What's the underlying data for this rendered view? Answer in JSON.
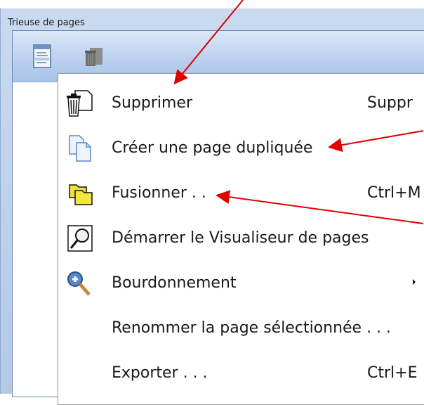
{
  "window": {
    "title": "Trieuse de pages"
  },
  "toolbar": {
    "icons": [
      "page-sorter-icon",
      "trash-icon"
    ]
  },
  "menu": {
    "items": [
      {
        "label": "Supprimer",
        "shortcut": "Suppr",
        "icon": "trash-icon"
      },
      {
        "label": "Créer une page dupliquée",
        "shortcut": "",
        "icon": "duplicate-pages-icon"
      },
      {
        "label": "Fusionner . .",
        "shortcut": "Ctrl+M",
        "icon": "folder-merge-icon"
      },
      {
        "label": "Démarrer le Visualiseur de pages",
        "shortcut": "",
        "icon": "magnifier-icon"
      },
      {
        "label": "Bourdonnement",
        "shortcut": "",
        "icon": "zoom-in-icon",
        "has_submenu": true
      },
      {
        "label": "Renommer la page sélectionnée . . .",
        "shortcut": "",
        "icon": ""
      },
      {
        "label": "Exporter . . .",
        "shortcut": "Ctrl+E",
        "icon": ""
      }
    ]
  },
  "colors": {
    "annotation_arrow": "#e00000",
    "window_frame": "#b4c9e6"
  }
}
